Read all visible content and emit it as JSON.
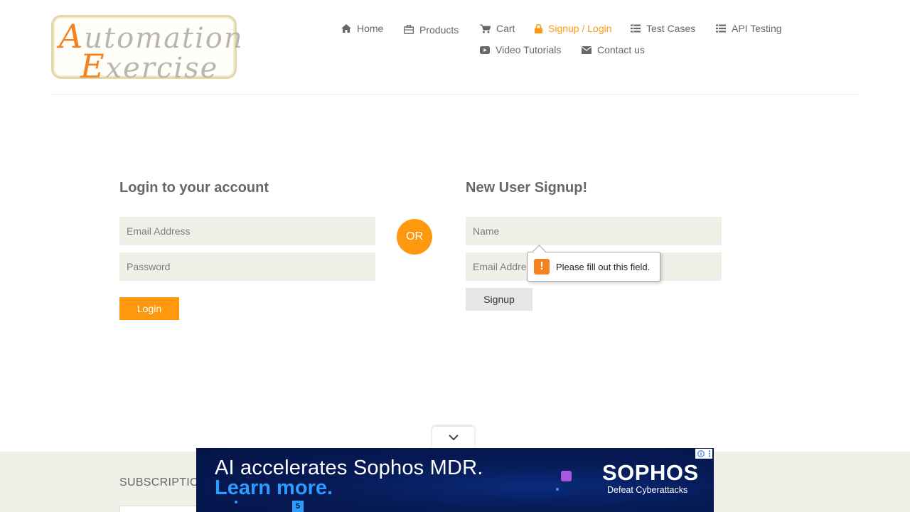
{
  "logo": {
    "line1_cap": "A",
    "line1_rest": "utomation",
    "line2_cap": "E",
    "line2_rest": "xercise"
  },
  "nav": [
    {
      "label": "Home",
      "icon": "home-icon"
    },
    {
      "label": "Products",
      "icon": "briefcase-icon"
    },
    {
      "label": "Cart",
      "icon": "cart-icon"
    },
    {
      "label": "Signup / Login",
      "icon": "lock-icon",
      "active": true
    },
    {
      "label": "Test Cases",
      "icon": "list-icon"
    },
    {
      "label": "API Testing",
      "icon": "list-icon"
    },
    {
      "label": "Video Tutorials",
      "icon": "youtube-icon"
    },
    {
      "label": "Contact us",
      "icon": "envelope-icon"
    }
  ],
  "login": {
    "title": "Login to your account",
    "email_placeholder": "Email Address",
    "password_placeholder": "Password",
    "button": "Login"
  },
  "or_label": "OR",
  "signup": {
    "title": "New User Signup!",
    "name_placeholder": "Name",
    "email_placeholder": "Email Address",
    "button": "Signup"
  },
  "validation_tooltip": {
    "icon": "!",
    "message": "Please fill out this field."
  },
  "footer": {
    "subscription_title": "SUBSCRIPTION"
  },
  "ad": {
    "headline": "AI accelerates Sophos MDR.",
    "cta": "Learn more.",
    "brand": "SOPHOS",
    "tagline": "Defeat Cyberattacks",
    "badge_letter": "5"
  },
  "colors": {
    "accent": "#fe980f",
    "input_bg": "#f0f0e9",
    "text": "#696763",
    "ad_bg": "#061a55",
    "ad_accent": "#2c9cff"
  }
}
